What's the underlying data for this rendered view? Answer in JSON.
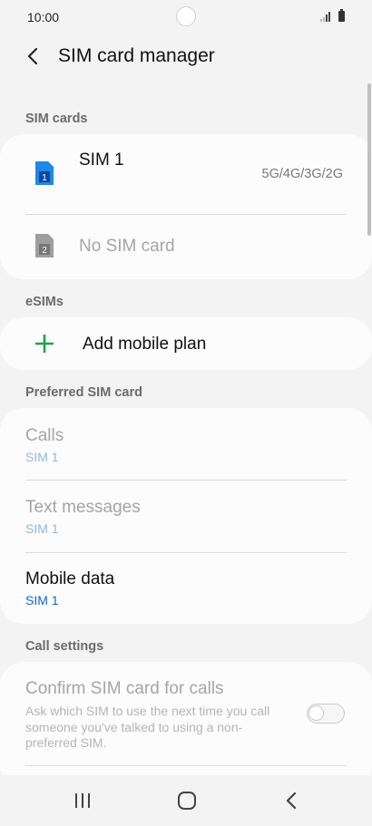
{
  "status_bar": {
    "time": "10:00"
  },
  "app_bar": {
    "title": "SIM card manager"
  },
  "sim_cards": {
    "section_label": "SIM cards",
    "sim1": {
      "name": "SIM 1",
      "network": "5G/4G/3G/2G",
      "slot_number": "1"
    },
    "sim2": {
      "name": "No SIM card",
      "slot_number": "2"
    }
  },
  "esims": {
    "section_label": "eSIMs",
    "add_plan_label": "Add mobile plan"
  },
  "preferred": {
    "section_label": "Preferred SIM card",
    "items": [
      {
        "title": "Calls",
        "value": "SIM 1",
        "enabled": false
      },
      {
        "title": "Text messages",
        "value": "SIM 1",
        "enabled": false
      },
      {
        "title": "Mobile data",
        "value": "SIM 1",
        "enabled": true
      }
    ]
  },
  "call_settings": {
    "section_label": "Call settings",
    "confirm_title": "Confirm SIM card for calls",
    "confirm_desc": "Ask which SIM to use the next time you call someone you've talked to using a non-preferred SIM.",
    "confirm_enabled": false
  },
  "colors": {
    "sim1_icon": "#1e88e5",
    "sim2_icon": "#9e9e9e",
    "add_icon": "#1aa34a",
    "sim_link_active": "#1565c0",
    "sim_link_disabled": "#90b8df"
  },
  "icons": {
    "back": "back-arrow-icon",
    "sim1": "sim-card-icon",
    "sim2": "sim-card-icon",
    "add": "plus-icon",
    "nav_recents": "recent-apps-icon",
    "nav_home": "home-icon",
    "nav_back": "back-icon"
  }
}
